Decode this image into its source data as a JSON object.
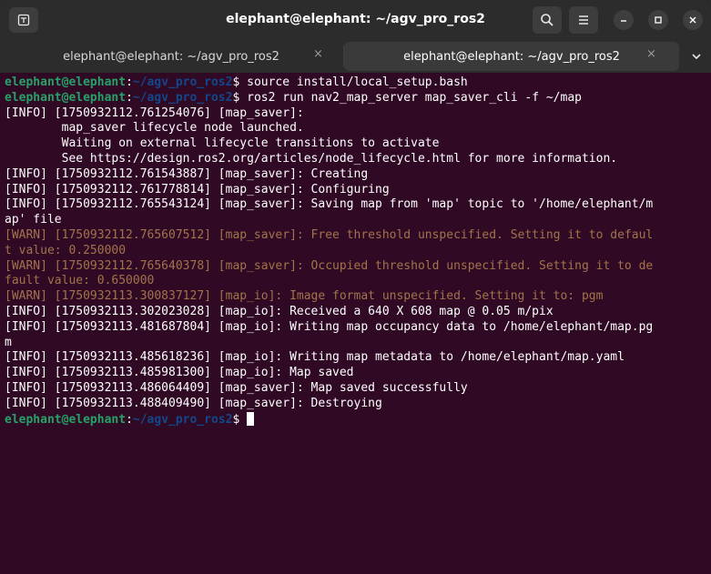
{
  "window": {
    "title": "elephant@elephant: ~/agv_pro_ros2"
  },
  "tabs": [
    {
      "label": "elephant@elephant: ~/agv_pro_ros2",
      "active": false,
      "close": "×"
    },
    {
      "label": "elephant@elephant: ~/agv_pro_ros2",
      "active": true,
      "close": "×"
    }
  ],
  "icons": {
    "new_tab": "new-tab-icon",
    "search": "search-icon",
    "menu": "hamburger-menu-icon",
    "minimize": "minimize-icon",
    "maximize": "maximize-icon",
    "close": "close-icon",
    "tabs_dropdown": "chevron-down-icon"
  },
  "colors": {
    "terminal_bg": "#300a24",
    "prompt_user": "#26a269",
    "prompt_path": "#12488b",
    "warn_text": "#a2734c",
    "text": "#ffffff"
  },
  "terminal": {
    "lines": [
      {
        "type": "prompt",
        "user": "elephant@elephant",
        "sep": ":",
        "path": "~/agv_pro_ros2",
        "sym": "$ ",
        "cmd": "source install/local_setup.bash"
      },
      {
        "type": "prompt",
        "user": "elephant@elephant",
        "sep": ":",
        "path": "~/agv_pro_ros2",
        "sym": "$ ",
        "cmd": "ros2 run nav2_map_server map_saver_cli -f ~/map"
      },
      {
        "type": "info",
        "text": "[INFO] [1750932112.761254076] [map_saver]:"
      },
      {
        "type": "info",
        "text": "        map_saver lifecycle node launched."
      },
      {
        "type": "info",
        "text": "        Waiting on external lifecycle transitions to activate"
      },
      {
        "type": "info",
        "text": "        See https://design.ros2.org/articles/node_lifecycle.html for more information."
      },
      {
        "type": "info",
        "text": "[INFO] [1750932112.761543887] [map_saver]: Creating"
      },
      {
        "type": "info",
        "text": "[INFO] [1750932112.761778814] [map_saver]: Configuring"
      },
      {
        "type": "info",
        "text": "[INFO] [1750932112.765543124] [map_saver]: Saving map from 'map' topic to '/home/elephant/m"
      },
      {
        "type": "info",
        "text": "ap' file"
      },
      {
        "type": "warn",
        "text": "[WARN] [1750932112.765607512] [map_saver]: Free threshold unspecified. Setting it to defaul"
      },
      {
        "type": "warn",
        "text": "t value: 0.250000"
      },
      {
        "type": "warn",
        "text": "[WARN] [1750932112.765640378] [map_saver]: Occupied threshold unspecified. Setting it to de"
      },
      {
        "type": "warn",
        "text": "fault value: 0.650000"
      },
      {
        "type": "warn",
        "text": "[WARN] [1750932113.300837127] [map_io]: Image format unspecified. Setting it to: pgm"
      },
      {
        "type": "info",
        "text": "[INFO] [1750932113.302023028] [map_io]: Received a 640 X 608 map @ 0.05 m/pix"
      },
      {
        "type": "info",
        "text": "[INFO] [1750932113.481687804] [map_io]: Writing map occupancy data to /home/elephant/map.pg"
      },
      {
        "type": "info",
        "text": "m"
      },
      {
        "type": "info",
        "text": "[INFO] [1750932113.485618236] [map_io]: Writing map metadata to /home/elephant/map.yaml"
      },
      {
        "type": "info",
        "text": "[INFO] [1750932113.485981300] [map_io]: Map saved"
      },
      {
        "type": "info",
        "text": "[INFO] [1750932113.486064409] [map_saver]: Map saved successfully"
      },
      {
        "type": "info",
        "text": "[INFO] [1750932113.488409490] [map_saver]: Destroying"
      },
      {
        "type": "prompt",
        "user": "elephant@elephant",
        "sep": ":",
        "path": "~/agv_pro_ros2",
        "sym": "$ ",
        "cmd": "",
        "cursor": true
      }
    ]
  }
}
